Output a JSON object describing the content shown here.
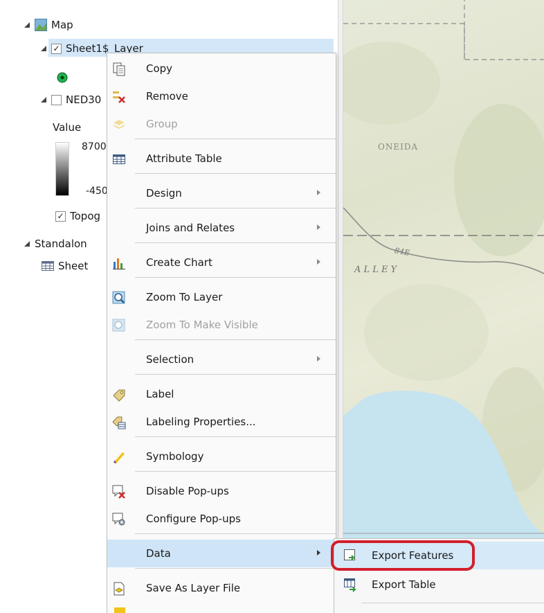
{
  "contents": {
    "map_label": "Map",
    "layer_label": "Sheet1$_Layer",
    "ned_label": "NED30",
    "value_label": "Value",
    "ramp_high": "8700",
    "ramp_low": "-450",
    "topo_label": "Topog",
    "standalone_label": "Standalon",
    "sheet_label": "Sheet"
  },
  "map_labels": {
    "county": "ONEIDA",
    "highway": "84E",
    "valley": "A L L E Y"
  },
  "context_menu": {
    "items": [
      {
        "label": "Copy",
        "icon": "copy-icon"
      },
      {
        "label": "Remove",
        "icon": "remove-icon"
      },
      {
        "label": "Group",
        "icon": "group-icon",
        "disabled": true
      },
      {
        "label": "Attribute Table",
        "icon": "attribute-table-icon"
      },
      {
        "label": "Design",
        "submenu": true
      },
      {
        "label": "Joins and Relates",
        "submenu": true
      },
      {
        "label": "Create Chart",
        "icon": "chart-icon",
        "submenu": true
      },
      {
        "label": "Zoom To Layer",
        "icon": "zoom-to-layer-icon"
      },
      {
        "label": "Zoom To Make Visible",
        "icon": "zoom-visible-icon",
        "disabled": true
      },
      {
        "label": "Selection",
        "submenu": true
      },
      {
        "label": "Label",
        "icon": "label-icon"
      },
      {
        "label": "Labeling Properties...",
        "icon": "labeling-properties-icon"
      },
      {
        "label": "Symbology",
        "icon": "symbology-icon"
      },
      {
        "label": "Disable Pop-ups",
        "icon": "disable-popups-icon"
      },
      {
        "label": "Configure Pop-ups",
        "icon": "configure-popups-icon"
      },
      {
        "label": "Data",
        "submenu": true,
        "highlighted": true
      },
      {
        "label": "Save As Layer File",
        "icon": "save-layer-file-icon"
      }
    ]
  },
  "submenu": {
    "items": [
      {
        "label": "Export Features",
        "icon": "export-features-icon",
        "highlighted": true
      },
      {
        "label": "Export Table",
        "icon": "export-table-icon"
      }
    ]
  },
  "colors": {
    "highlight": "#cfe5f7",
    "callout": "#d21f2b",
    "accent": "#2e7bc4"
  }
}
